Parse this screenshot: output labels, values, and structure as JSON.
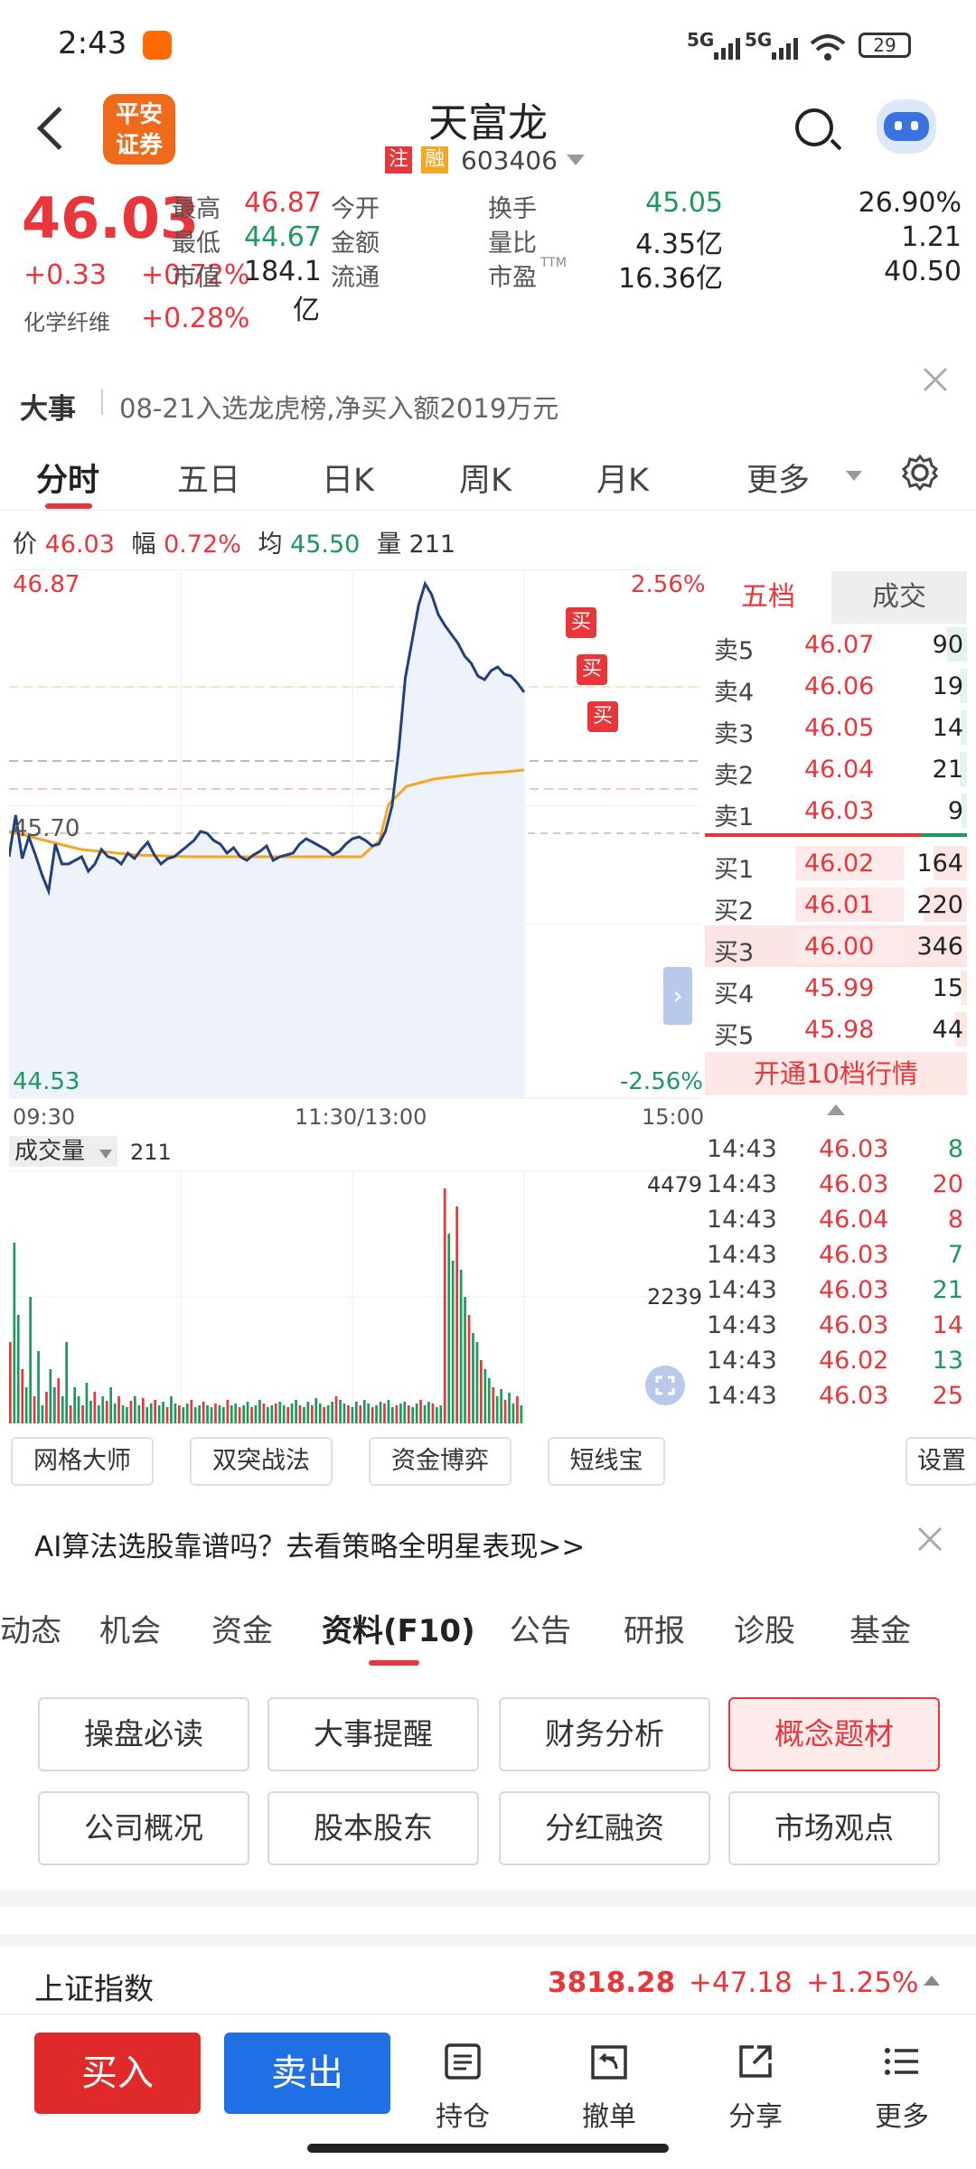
{
  "status_bar": {
    "time": "2:43",
    "net1": "5G",
    "net2": "5G",
    "battery": "29"
  },
  "header": {
    "title": "天富龙",
    "logo_line1": "平安",
    "logo_line2": "证券",
    "tag1": "注",
    "tag2": "融",
    "code": "603406"
  },
  "quote": {
    "price": "46.03",
    "change": "+0.33",
    "change_pct": "+0.72%",
    "sector": "化学纤维",
    "sector_pct": "+0.28%",
    "fields": [
      {
        "label": "最高",
        "value": "46.87",
        "color": "red"
      },
      {
        "label": "今开",
        "value": "45.05",
        "color": "green"
      },
      {
        "label": "换手",
        "value": "26.90%",
        "color": "dark"
      },
      {
        "label": "最低",
        "value": "44.67",
        "color": "green"
      },
      {
        "label": "金额",
        "value": "4.35亿",
        "color": "dark"
      },
      {
        "label": "量比",
        "value": "1.21",
        "color": "dark"
      },
      {
        "label": "市值",
        "value": "184.1亿",
        "color": "dark"
      },
      {
        "label": "流通",
        "value": "16.36亿",
        "color": "dark"
      },
      {
        "label": "市盈",
        "value": "40.50",
        "color": "dark",
        "sup": "TTM"
      }
    ]
  },
  "news": {
    "label": "大事",
    "text": "08-21入选龙虎榜,净买入额2019万元"
  },
  "tabs": [
    "分时",
    "五日",
    "日K",
    "周K",
    "月K",
    "更多"
  ],
  "info_row": {
    "price_label": "价",
    "price": "46.03",
    "amp_label": "幅",
    "amp": "0.72%",
    "avg_label": "均",
    "avg": "45.50",
    "vol_label": "量",
    "vol": "211"
  },
  "chart_labels": {
    "high": "46.87",
    "low": "44.53",
    "mid": "45.70",
    "up_pct": "2.56%",
    "down_pct": "-2.56%",
    "buy": "买"
  },
  "time_axis": [
    "09:30",
    "11:30/13:00",
    "15:00"
  ],
  "order_book": {
    "tab1": "五档",
    "tab2": "成交",
    "asks": [
      {
        "label": "卖5",
        "price": "46.07",
        "vol": "90"
      },
      {
        "label": "卖4",
        "price": "46.06",
        "vol": "19"
      },
      {
        "label": "卖3",
        "price": "46.05",
        "vol": "14"
      },
      {
        "label": "卖2",
        "price": "46.04",
        "vol": "21"
      },
      {
        "label": "卖1",
        "price": "46.03",
        "vol": "9"
      }
    ],
    "bids": [
      {
        "label": "买1",
        "price": "46.02",
        "vol": "164"
      },
      {
        "label": "买2",
        "price": "46.01",
        "vol": "220"
      },
      {
        "label": "买3",
        "price": "46.00",
        "vol": "346"
      },
      {
        "label": "买4",
        "price": "45.99",
        "vol": "15"
      },
      {
        "label": "买5",
        "price": "45.98",
        "vol": "44"
      }
    ],
    "cta": "开通10档行情"
  },
  "volume": {
    "label": "成交量",
    "value": "211",
    "max": "4479",
    "mid": "2239"
  },
  "trades": [
    {
      "time": "14:43",
      "price": "46.03",
      "vol": "8",
      "pc": "red",
      "vc": "green"
    },
    {
      "time": "14:43",
      "price": "46.03",
      "vol": "20",
      "pc": "red",
      "vc": "red"
    },
    {
      "time": "14:43",
      "price": "46.04",
      "vol": "8",
      "pc": "red",
      "vc": "red"
    },
    {
      "time": "14:43",
      "price": "46.03",
      "vol": "7",
      "pc": "red",
      "vc": "green"
    },
    {
      "time": "14:43",
      "price": "46.03",
      "vol": "21",
      "pc": "red",
      "vc": "green"
    },
    {
      "time": "14:43",
      "price": "46.03",
      "vol": "14",
      "pc": "red",
      "vc": "red"
    },
    {
      "time": "14:43",
      "price": "46.02",
      "vol": "13",
      "pc": "red",
      "vc": "green"
    },
    {
      "time": "14:43",
      "price": "46.03",
      "vol": "25",
      "pc": "red",
      "vc": "red"
    }
  ],
  "tools": [
    "网格大师",
    "双突战法",
    "资金博弈",
    "短线宝"
  ],
  "settings": "设置",
  "ai_banner": "AI算法选股靠谱吗？去看策略全明星表现>>",
  "f10_tabs": [
    "动态",
    "机会",
    "资金",
    "资料(F10)",
    "公告",
    "研报",
    "诊股",
    "基金"
  ],
  "f10_grid": [
    "操盘必读",
    "大事提醒",
    "财务分析",
    "概念题材",
    "公司概况",
    "股本股东",
    "分红融资",
    "市场观点"
  ],
  "index_bar": {
    "name": "上证指数",
    "value": "3818.28",
    "change": "+47.18",
    "pct": "+1.25%"
  },
  "bottom": {
    "buy": "买入",
    "sell": "卖出",
    "items": [
      "持仓",
      "撤单",
      "分享",
      "更多"
    ]
  },
  "colors": {
    "red": "#e8363b",
    "green": "#1a9a5c",
    "blue": "#1f6fe5",
    "orange": "#f06a1c",
    "price_line": "#23407e",
    "avg_line": "#f5a623"
  }
}
